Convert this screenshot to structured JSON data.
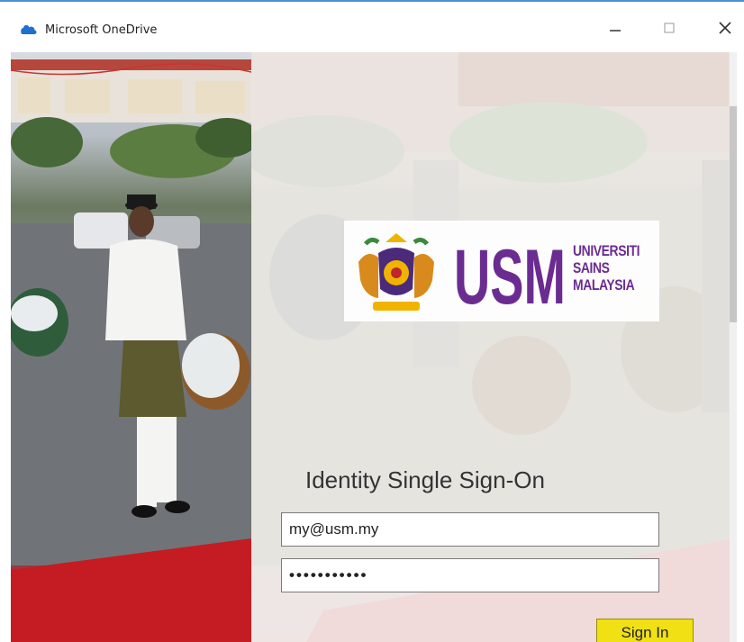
{
  "window": {
    "title": "Microsoft OneDrive",
    "app_icon": "onedrive-cloud-icon",
    "minimize_icon": "minimize-icon",
    "maximize_icon": "maximize-icon",
    "close_icon": "close-icon"
  },
  "logo": {
    "crest_icon": "university-crest-icon",
    "mark": "USM",
    "name_lines": [
      "UNIVERSITI",
      "SAINS",
      "MALAYSIA"
    ],
    "brand_color": "#6b2c91"
  },
  "signin": {
    "heading": "Identity Single Sign-On",
    "username_value": "my@usm.my",
    "password_value": "•••••••••••",
    "button_label": "Sign In",
    "button_color": "#f0e014"
  }
}
